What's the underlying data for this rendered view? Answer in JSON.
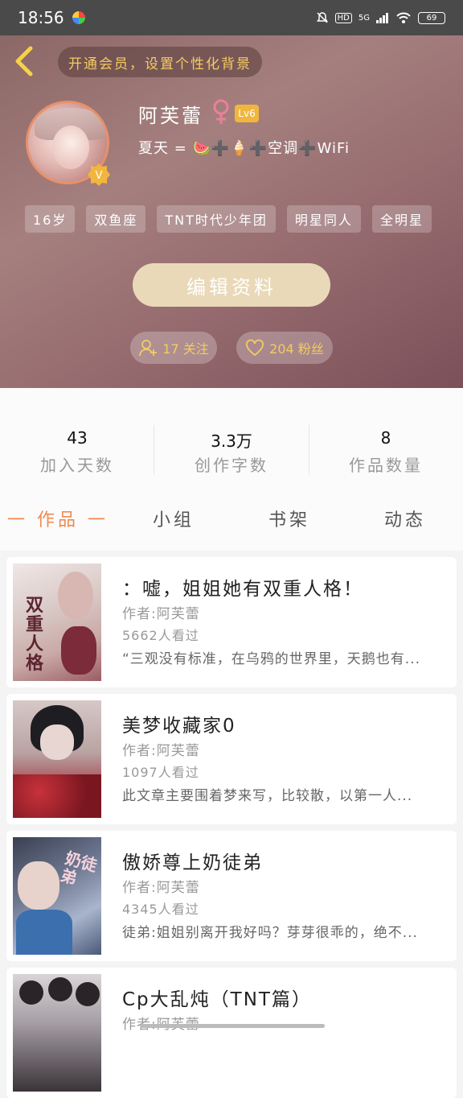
{
  "status_bar": {
    "time": "18:56",
    "hd_label": "HD",
    "network": "5G",
    "battery": "69"
  },
  "header": {
    "vip_banner": "开通会员，设置个性化背景",
    "username": "阿芙蕾",
    "level": "Lv6",
    "signature": "夏天 = 🍉➕🍦➕空调➕WiFi",
    "tags": [
      "16岁",
      "双鱼座",
      "TNT时代少年团",
      "明星同人",
      "全明星"
    ],
    "edit_button": "编辑资料",
    "follow_label": "17 关注",
    "fans_label": "204 粉丝"
  },
  "stats": [
    {
      "value": "43",
      "label": "加入天数"
    },
    {
      "value": "3.3万",
      "label": "创作字数"
    },
    {
      "value": "8",
      "label": "作品数量"
    }
  ],
  "tabs": [
    "一 作品 一",
    "小组",
    "书架",
    "动态"
  ],
  "books": [
    {
      "title": "：嘘，姐姐她有双重人格！",
      "author": "作者:阿芙蕾",
      "views": "5662人看过",
      "desc": "“三观没有标准，在乌鸦的世界里，天鹅也有...",
      "cover_text": "双重人格"
    },
    {
      "title": "美梦收藏家0",
      "author": "作者:阿芙蕾",
      "views": "1097人看过",
      "desc": "此文章主要围着梦来写，比较散，以第一人...",
      "cover_text": ""
    },
    {
      "title": "傲娇尊上奶徒弟",
      "author": "作者:阿芙蕾",
      "views": "4345人看过",
      "desc": "徒弟:姐姐别离开我好吗？芽芽很乖的，绝不...",
      "cover_text": "奶徒弟"
    },
    {
      "title": "Cp大乱炖（TNT篇）",
      "author": "作者:阿芙蕾",
      "views": "",
      "desc": "",
      "cover_text": ""
    }
  ],
  "colors": {
    "accent_orange": "#f08a52",
    "gold": "#f3cc63",
    "level_badge": "#f2b63c"
  }
}
